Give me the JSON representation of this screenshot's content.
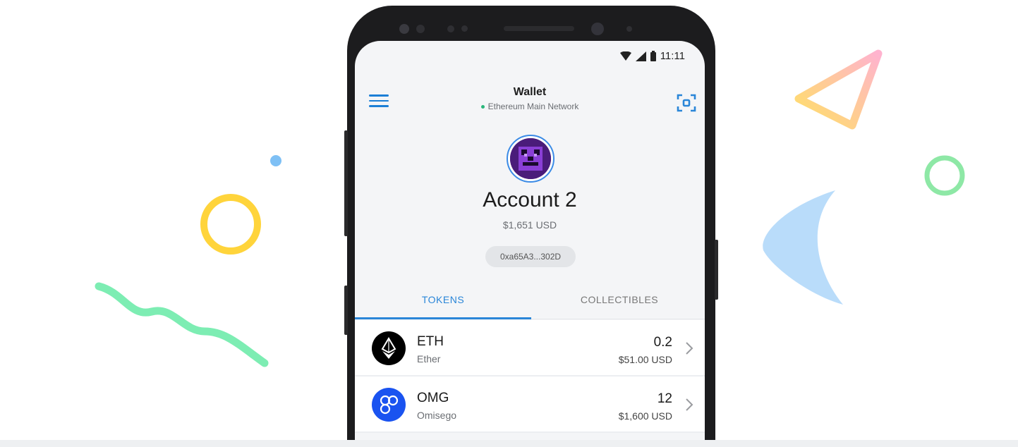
{
  "status_bar": {
    "time": "11:11"
  },
  "header": {
    "title": "Wallet",
    "network": "Ethereum Main Network"
  },
  "account": {
    "name": "Account 2",
    "balance": "$1,651 USD",
    "address": "0xa65A3...302D"
  },
  "tabs": [
    {
      "label": "TOKENS",
      "active": true
    },
    {
      "label": "COLLECTIBLES",
      "active": false
    }
  ],
  "tokens": [
    {
      "symbol": "ETH",
      "name": "Ether",
      "amount": "0.2",
      "usd": "$51.00 USD",
      "icon": "ethereum-icon",
      "color": "#000000"
    },
    {
      "symbol": "OMG",
      "name": "Omisego",
      "amount": "12",
      "usd": "$1,600 USD",
      "icon": "omisego-icon",
      "color": "#1a53f0"
    }
  ],
  "colors": {
    "accent": "#2a86d8",
    "network_dot": "#29b67a",
    "avatar_bg": "#4a1c7a"
  }
}
